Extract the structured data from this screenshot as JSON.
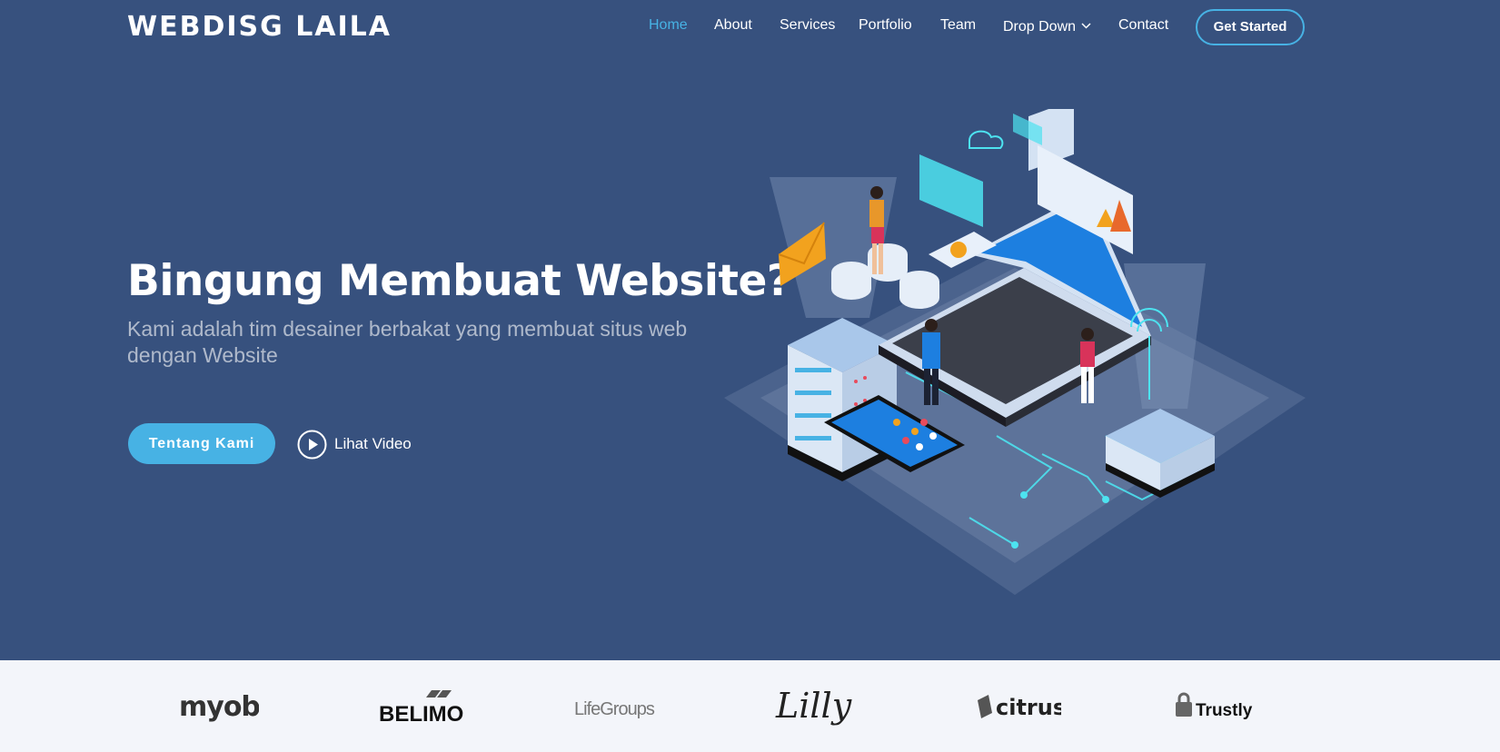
{
  "header": {
    "logo": "WEBDISG LAILA",
    "nav": [
      {
        "label": "Home",
        "active": true
      },
      {
        "label": "About"
      },
      {
        "label": "Services"
      },
      {
        "label": "Portfolio"
      },
      {
        "label": "Team"
      },
      {
        "label": "Drop Down",
        "icon": "chevron-down-icon"
      },
      {
        "label": "Contact"
      }
    ],
    "cta_label": "Get Started"
  },
  "hero": {
    "title": "Bingung Membuat Website?",
    "subtitle": "Kami adalah tim desainer berbakat yang membuat situs web dengan Website",
    "primary_button": "Tentang Kami",
    "video_link": "Lihat Video",
    "play_icon": "play-circle-icon"
  },
  "clients": [
    {
      "name": "myob"
    },
    {
      "name": "BELIMO"
    },
    {
      "name": "LifeGroups"
    },
    {
      "name": "Lilly"
    },
    {
      "name": "citrus"
    },
    {
      "name": "Trustly"
    }
  ],
  "colors": {
    "background": "#37517e",
    "accent": "#47b2e4",
    "clients_bg": "#f3f5fa"
  }
}
